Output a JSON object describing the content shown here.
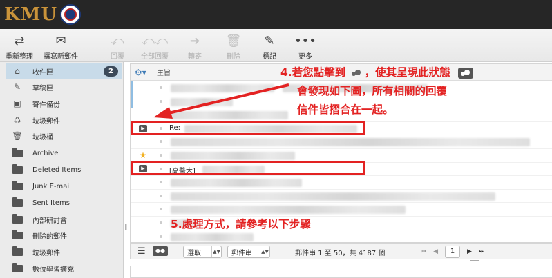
{
  "header": {
    "logo_text": "KMU"
  },
  "toolbar": {
    "buttons": [
      {
        "label": "重新整理",
        "icon": "refresh-icon",
        "enabled": true
      },
      {
        "label": "撰寫新郵件",
        "icon": "compose-icon",
        "enabled": true
      },
      {
        "label": "回覆",
        "icon": "reply-icon",
        "enabled": false
      },
      {
        "label": "全部回覆",
        "icon": "reply-all-icon",
        "enabled": false
      },
      {
        "label": "轉寄",
        "icon": "forward-icon",
        "enabled": false
      },
      {
        "label": "刪除",
        "icon": "trash-icon",
        "enabled": false
      },
      {
        "label": "標記",
        "icon": "mark-icon",
        "enabled": true
      },
      {
        "label": "更多",
        "icon": "more-icon",
        "enabled": true
      }
    ]
  },
  "sidebar": {
    "folders": [
      {
        "label": "收件匣",
        "icon": "inbox-icon",
        "selected": true,
        "unread": "2"
      },
      {
        "label": "草稿匣",
        "icon": "pencil-icon"
      },
      {
        "label": "寄件備份",
        "icon": "sent-backup-icon"
      },
      {
        "label": "垃圾郵件",
        "icon": "junk-icon"
      },
      {
        "label": "垃圾桶",
        "icon": "trash-icon"
      },
      {
        "label": "Archive",
        "icon": "folder-icon"
      },
      {
        "label": "Deleted Items",
        "icon": "folder-icon"
      },
      {
        "label": "Junk E-mail",
        "icon": "folder-icon"
      },
      {
        "label": "Sent Items",
        "icon": "folder-icon"
      },
      {
        "label": "內部研討會",
        "icon": "folder-icon"
      },
      {
        "label": "刪除的郵件",
        "icon": "folder-icon"
      },
      {
        "label": "垃圾郵件",
        "icon": "folder-icon"
      },
      {
        "label": "數位學習擴充",
        "icon": "folder-icon"
      }
    ]
  },
  "message_list": {
    "column_subject": "主旨",
    "rows": [
      {
        "subject": ""
      },
      {
        "subject": ""
      },
      {
        "subject": ""
      },
      {
        "subject": "Re:",
        "thread": true
      },
      {
        "subject": ""
      },
      {
        "subject": "",
        "flagged": true
      },
      {
        "subject": "[高醫大]",
        "thread": true
      },
      {
        "subject": ""
      },
      {
        "subject": ""
      },
      {
        "subject": ""
      },
      {
        "subject": ""
      },
      {
        "subject": ""
      }
    ]
  },
  "list_footer": {
    "select_label": "選取",
    "threads_label": "郵件串",
    "count_text": "郵件串 1 至 50，共 4187 個",
    "page": "1"
  },
  "annotations": {
    "step4_line1_a": "4.若您點擊到",
    "step4_line1_b": "，使其呈現此狀態",
    "step4_line2": "會發現如下圖，所有相關的回覆",
    "step4_line3": "信件皆摺合在一起。",
    "step5": "5.處理方式，請參考以下步驟",
    "color": "#e32222"
  }
}
